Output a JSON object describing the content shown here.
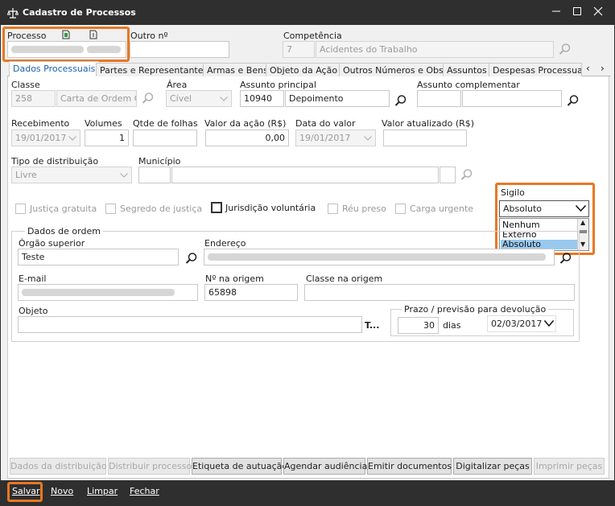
{
  "window": {
    "title": "Cadastro de Processos"
  },
  "header": {
    "processo_label": "Processo",
    "outro_label": "Outro nº",
    "competencia_label": "Competência",
    "competencia_code": "7",
    "competencia_value": "Acidentes do Trabalho"
  },
  "tabs": [
    {
      "label": "Dados Processuais"
    },
    {
      "label": "Partes e Representantes"
    },
    {
      "label": "Armas e Bens"
    },
    {
      "label": "Objeto da Ação"
    },
    {
      "label": "Outros Números e Obs."
    },
    {
      "label": "Assuntos"
    },
    {
      "label": "Despesas Processuais"
    }
  ],
  "form": {
    "classe_label": "Classe",
    "classe_code": "258",
    "classe_value": "Carta de Ordem Cí",
    "area_label": "Área",
    "area_value": "Cível",
    "assunto_principal_label": "Assunto principal",
    "assunto_principal_code": "10940",
    "assunto_principal_value": "Depoimento",
    "assunto_complementar_label": "Assunto complementar",
    "recebimento_label": "Recebimento",
    "recebimento_value": "19/01/2017",
    "volumes_label": "Volumes",
    "volumes_value": "1",
    "qtde_folhas_label": "Qtde de folhas",
    "valor_acao_label": "Valor da ação (R$)",
    "valor_acao_value": "0,00",
    "data_valor_label": "Data do valor",
    "data_valor_value": "19/01/2017",
    "valor_atualizado_label": "Valor atualizado (R$)",
    "tipo_distribuicao_label": "Tipo de distribuição",
    "tipo_distribuicao_value": "Livre",
    "municipio_label": "Município",
    "sigilo_label": "Sigilo",
    "sigilo_value": "Absoluto",
    "sigilo_options": [
      "Nenhum",
      "Externo",
      "Absoluto"
    ]
  },
  "checkboxes": [
    {
      "label": "Justiça gratuita"
    },
    {
      "label": "Segredo de justiça"
    },
    {
      "label": "Jurisdição voluntária"
    },
    {
      "label": "Réu preso"
    },
    {
      "label": "Carga urgente"
    }
  ],
  "ordem": {
    "group_label": "Dados de ordem",
    "orgao_label": "Órgão superior",
    "orgao_value": "Teste",
    "endereco_label": "Endereço",
    "email_label": "E-mail",
    "numero_origem_label": "Nº na origem",
    "numero_origem_value": "65898",
    "classe_origem_label": "Classe na origem",
    "objeto_label": "Objeto",
    "objeto_more": "T...",
    "prazo_label": "Prazo / previsão para devolução",
    "prazo_value": "30",
    "prazo_unit": "dias",
    "prazo_date": "02/03/2017"
  },
  "buttons": [
    {
      "label": "Dados da distribuição"
    },
    {
      "label": "Distribuir processo"
    },
    {
      "label": "Etiqueta de autuação"
    },
    {
      "label": "Agendar audiência"
    },
    {
      "label": "Emitir documentos"
    },
    {
      "label": "Digitalizar peças"
    },
    {
      "label": "Imprimir peças"
    }
  ],
  "footer": {
    "salvar": "Salvar",
    "novo": "Novo",
    "limpar": "Limpar",
    "fechar": "Fechar"
  },
  "colors": {
    "highlight": "#e87722",
    "titlebar": "#2f2f2f",
    "selection": "#99c9ef"
  }
}
